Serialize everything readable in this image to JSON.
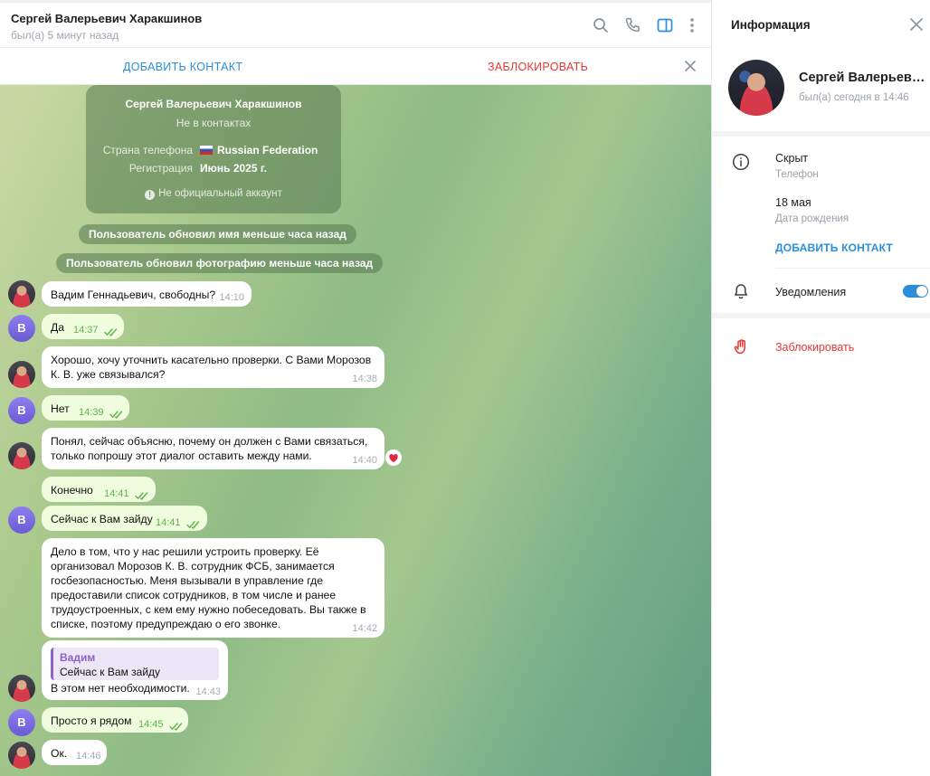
{
  "colors": {
    "accent": "#2a8fd8",
    "danger": "#e53935",
    "outgoing_bubble": "#effdde",
    "incoming_bubble": "#ffffff",
    "read_ticks": "#5fb24a"
  },
  "header": {
    "title": "Сергей Валерьевич Харакшинов",
    "status": "был(а) 5 минут назад",
    "icons": [
      "search-icon",
      "phone-icon",
      "sidebar-toggle-icon",
      "more-vertical-icon"
    ]
  },
  "action_bar": {
    "add_contact": "ДОБАВИТЬ КОНТАКТ",
    "block": "ЗАБЛОКИРОВАТЬ",
    "close_icon": "close-icon"
  },
  "info_card": {
    "name": "Сергей Валерьевич Харакшинов",
    "subtitle": "Не в контактах",
    "phone_country_label": "Страна телефона",
    "phone_country_value": "Russian Federation",
    "registration_label": "Регистрация",
    "registration_value": "Июнь 2025 г.",
    "note": "Не официальный аккаунт"
  },
  "service_messages": [
    "Пользователь обновил имя меньше часа назад",
    "Пользователь обновил фотографию меньше часа назад"
  ],
  "messages": [
    {
      "text": "Вадим Геннадьевич, свободны?",
      "time": "14:10",
      "outgoing": false,
      "avatar": "photo"
    },
    {
      "text": "Да",
      "time": "14:37",
      "outgoing": true,
      "avatar": "В"
    },
    {
      "text": "Хорошо, хочу уточнить касательно проверки. С Вами Морозов\nК. В. уже связывался?",
      "time": "14:38",
      "outgoing": false,
      "avatar": "photo"
    },
    {
      "text": "Нет",
      "time": "14:39",
      "outgoing": true,
      "avatar": "В"
    },
    {
      "text": "Понял, сейчас объясню, почему он должен с Вами связаться,\nтолько попрошу этот диалог оставить между нами.",
      "time": "14:40",
      "outgoing": false,
      "avatar": "photo",
      "reaction": "heart"
    },
    {
      "text": "Конечно",
      "time": "14:41",
      "outgoing": true,
      "avatar": ""
    },
    {
      "text": "Сейчас к Вам зайду",
      "time": "14:41",
      "outgoing": true,
      "avatar": "В"
    },
    {
      "text": "Дело в том, что у нас решили устроить проверку. Её\nорганизовал Морозов К. В. сотрудник ФСБ, занимается\nгосбезопасностью. Меня вызывали в управление где\nпредоставили список сотрудников, в том числе и ранее\nтрудоустроенных, с кем ему нужно побеседовать. Вы также в\nсписке, поэтому предупреждаю о его звонке.",
      "time": "14:42",
      "outgoing": false,
      "avatar": ""
    },
    {
      "text": "В этом нет необходимости.",
      "time": "14:43",
      "outgoing": false,
      "avatar": "photo",
      "reply": {
        "name": "Вадим",
        "text": "Сейчас к Вам зайду"
      }
    },
    {
      "text": "Просто я рядом",
      "time": "14:45",
      "outgoing": true,
      "avatar": "В"
    },
    {
      "text": "Ок.",
      "time": "14:46",
      "outgoing": false,
      "avatar": "photo"
    }
  ],
  "info_panel": {
    "title": "Информация",
    "name": "Сергей Валерьевич Харакшинов",
    "last_seen": "был(а) сегодня в 14:46",
    "phone_value": "Скрыт",
    "phone_label": "Телефон",
    "birthday_value": "18 мая",
    "birthday_label": "Дата рождения",
    "add_contact": "ДОБАВИТЬ КОНТАКТ",
    "notifications_label": "Уведомления",
    "notifications_on": true,
    "block": "Заблокировать"
  }
}
